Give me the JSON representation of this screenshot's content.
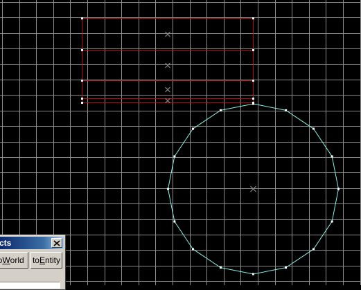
{
  "viewport": {
    "background_color": "#000000",
    "grid_color": "#8c8c8c",
    "outline_color": "#b80c16",
    "circle_color": "#8cf0e6",
    "vertex_color": "#ffffff",
    "center_marker_color": "#8c8c8c",
    "center_marker_icon": "cross-icon"
  },
  "tool_window": {
    "title": "cts",
    "close_icon": "close-icon",
    "buttons": [
      {
        "prefix": "to",
        "mnemonic": "W",
        "suffix": "orld"
      },
      {
        "prefix": "to",
        "mnemonic": "E",
        "suffix": "ntity"
      }
    ]
  }
}
